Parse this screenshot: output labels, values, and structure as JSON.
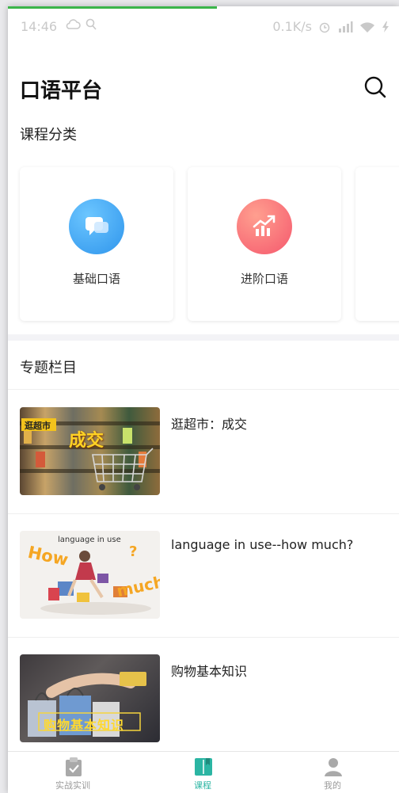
{
  "status_bar": {
    "time": "14:46",
    "speed": "0.1K/s"
  },
  "header": {
    "title": "口语平台"
  },
  "categories_section": {
    "title": "课程分类",
    "items": [
      {
        "label": "基础口语",
        "icon": "chat-bubbles-icon",
        "color": "#3aa8f0"
      },
      {
        "label": "进阶口语",
        "icon": "trending-up-icon",
        "color": "#f86f78"
      }
    ]
  },
  "topics_section": {
    "title": "专题栏目",
    "items": [
      {
        "title": "逛超市：成交",
        "thumb_text": [
          "逛超市",
          "成交"
        ]
      },
      {
        "title": "language in use--how much?",
        "thumb_text": [
          "language in use",
          "How",
          "much",
          "?"
        ]
      },
      {
        "title": "购物基本知识",
        "thumb_text": [
          "购物基本知识"
        ]
      }
    ]
  },
  "tabbar": {
    "items": [
      {
        "label": "实战实训",
        "icon": "clipboard-check-icon",
        "active": false
      },
      {
        "label": "课程",
        "icon": "book-icon",
        "active": true
      },
      {
        "label": "我的",
        "icon": "person-icon",
        "active": false
      }
    ]
  },
  "colors": {
    "accent": "#2bb5a3",
    "progress": "#3bb54a"
  }
}
